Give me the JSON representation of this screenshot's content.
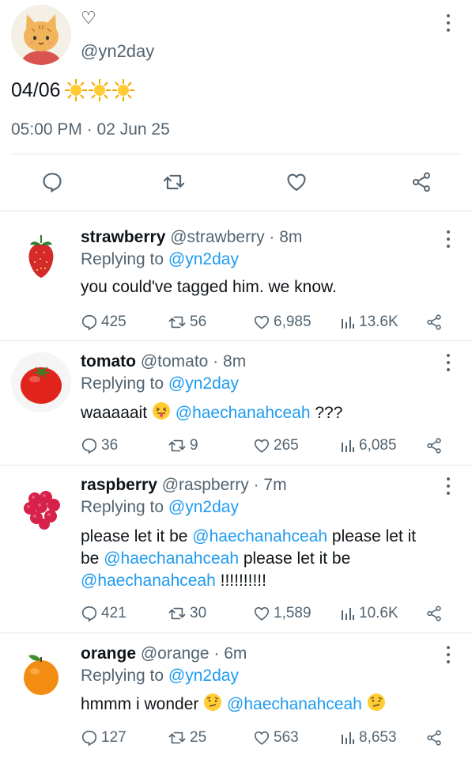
{
  "main_tweet": {
    "name": "♡",
    "handle": "@yn2day",
    "text": "04/06",
    "suns": [
      "sun-emoji",
      "sun-emoji",
      "sun-emoji"
    ],
    "timestamp": "05:00 PM · 02 Jun 25",
    "actions": [
      "reply-icon",
      "retweet-icon",
      "like-icon",
      "share-icon"
    ]
  },
  "replies": [
    {
      "name": "strawberry",
      "handle": "@strawberry",
      "time": " · 8m",
      "replying_label": "Replying to ",
      "replying_to": "@yn2day",
      "text_parts": [
        "you could've tagged him. we know."
      ],
      "counts": {
        "replies": "425",
        "retweets": "56",
        "likes": "6,985",
        "views": "13.6K"
      },
      "avatar": "strawberry"
    },
    {
      "name": "tomato",
      "handle": "@tomato",
      "time": " · 8m",
      "replying_label": "Replying to ",
      "replying_to": "@yn2day",
      "text_parts": [
        "waaaaait ",
        "@haechanahceah",
        " ???"
      ],
      "counts": {
        "replies": "36",
        "retweets": "9",
        "likes": "265",
        "views": "6,085"
      },
      "avatar": "tomato"
    },
    {
      "name": "raspberry",
      "handle": "@raspberry",
      "time": " · 7m",
      "replying_label": "Replying to ",
      "replying_to": "@yn2day",
      "text_lines": [
        [
          "please let it be ",
          "@haechanahceah",
          " please let it"
        ],
        [
          "be ",
          "@haechanahceah",
          " please let it be"
        ],
        [
          "@haechanahceah",
          " !!!!!!!!!!"
        ]
      ],
      "counts": {
        "replies": "421",
        "retweets": "30",
        "likes": "1,589",
        "views": "10.6K"
      },
      "avatar": "raspberry"
    },
    {
      "name": "orange",
      "handle": "@orange",
      "time": " · 6m",
      "replying_label": "Replying to ",
      "replying_to": "@yn2day",
      "text_parts": [
        "hmmm i wonder ",
        "@haechanahceah"
      ],
      "counts": {
        "replies": "127",
        "retweets": "25",
        "likes": "563",
        "views": "8,653"
      },
      "avatar": "orange"
    }
  ],
  "colors": {
    "link": "#1d9bf0",
    "muted": "#536471",
    "text": "#0f1419",
    "divider": "#e4e7ea"
  }
}
